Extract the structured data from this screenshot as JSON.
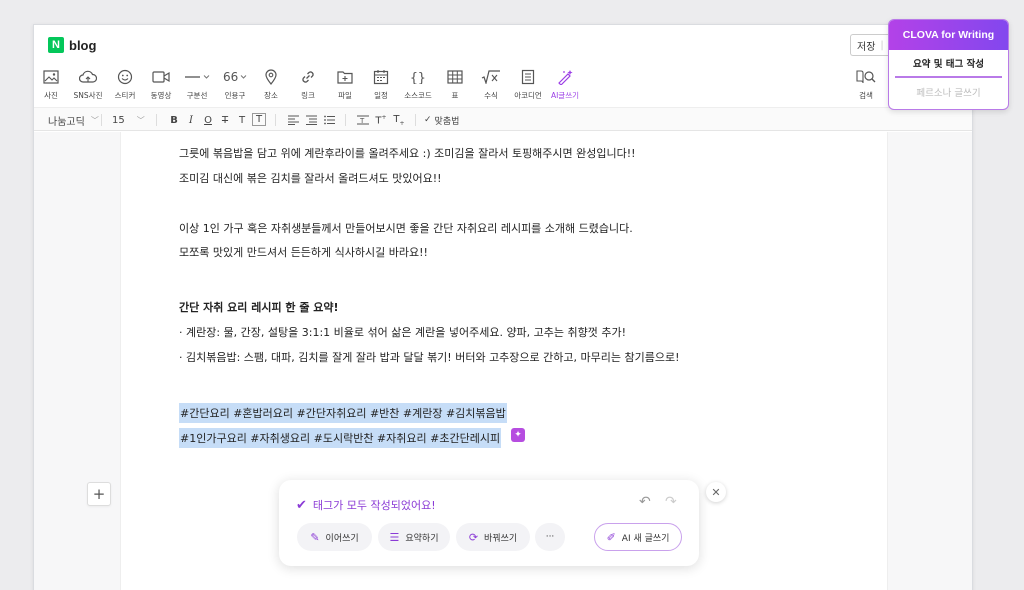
{
  "app": {
    "logo_letter": "N",
    "logo_text": "blog",
    "save_label": "저장",
    "save_sep": "|"
  },
  "toolbar": {
    "items": [
      {
        "label": "사진",
        "icon": "photo-icon"
      },
      {
        "label": "SNS사진",
        "icon": "cloud-icon"
      },
      {
        "label": "스티커",
        "icon": "sticker-icon"
      },
      {
        "label": "동영상",
        "icon": "video-icon"
      },
      {
        "label": "구분선",
        "icon": "divider-icon"
      },
      {
        "label": "인용구",
        "icon": "quote-icon"
      },
      {
        "label": "장소",
        "icon": "location-icon"
      },
      {
        "label": "링크",
        "icon": "link-icon"
      },
      {
        "label": "파일",
        "icon": "file-icon"
      },
      {
        "label": "일정",
        "icon": "calendar-icon"
      },
      {
        "label": "소스코드",
        "icon": "code-icon"
      },
      {
        "label": "표",
        "icon": "table-icon"
      },
      {
        "label": "수식",
        "icon": "formula-icon"
      },
      {
        "label": "아코디언",
        "icon": "accordion-icon"
      },
      {
        "label": "AI글쓰기",
        "icon": "ai-writing-icon"
      }
    ],
    "search_label": "검색"
  },
  "format": {
    "font": "나눔고딕",
    "size": "15",
    "spellcheck": "맞춤법"
  },
  "content": {
    "lines": [
      "그릇에 볶음밥을 담고 위에 계란후라이를 올려주세요 :) 조미김을 잘라서 토핑해주시면 완성입니다!!",
      "조미김 대신에 볶은 김치를 잘라서 올려드셔도 맛있어요!!",
      "이상 1인 가구 혹은 자취생분들께서 만들어보시면 좋을 간단 자취요리 레시피를 소개해 드렸습니다.",
      "모쪼록 맛있게 만드셔서 든든하게 식사하시길 바라요!!"
    ],
    "summary_title": "간단 자취 요리 레시피 한 줄 요약!",
    "summary_items": [
      "· 계란장: 물, 간장, 설탕을 3:1:1 비율로 섞어 삶은 계란을 넣어주세요. 양파, 고추는 취향껏 추가!",
      "· 김치볶음밥: 스팸, 대파, 김치를 잘게 잘라 밥과 달달 볶기! 버터와 고추장으로 간하고, 마무리는 참기름으로!"
    ],
    "tags_line1": "#간단요리 #혼밥러요리 #간단자취요리 #반찬 #계란장 #김치볶음밥",
    "tags_line2": "#1인가구요리 #자취생요리 #도시락반찬 #자취요리 #초간단레시피"
  },
  "ai_panel": {
    "status": "태그가 모두 작성되었어요!",
    "buttons": {
      "continue": "이어쓰기",
      "summarize": "요약하기",
      "rewrite": "바꿔쓰기",
      "more": "···",
      "new": "AI 새 글쓰기"
    }
  },
  "clova": {
    "title": "CLOVA for Writing",
    "items": [
      "요약 및 태그 작성",
      "페르소나 글쓰기"
    ]
  }
}
